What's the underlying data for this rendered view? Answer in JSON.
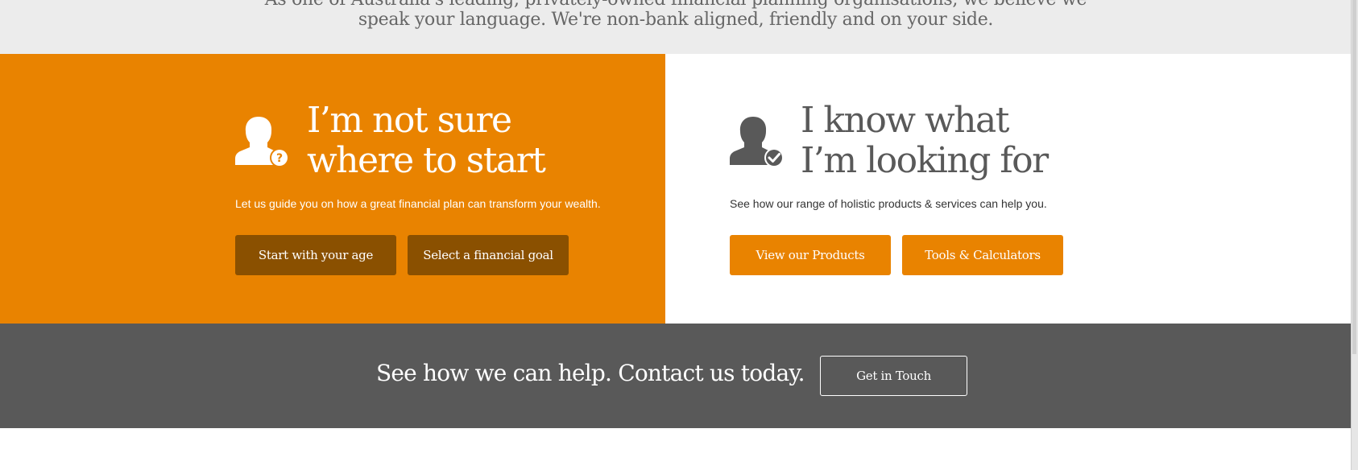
{
  "intro": {
    "line1": "As one of Australia's leading, privately-owned financial planning organisations, we believe we",
    "line2": "speak your language. We're non-bank aligned, friendly and on your side."
  },
  "colors": {
    "brand_orange": "#e98300",
    "dark_orange": "#8a5000",
    "charcoal": "#595959",
    "light_gray": "#ececec"
  },
  "not_sure": {
    "icon": "person-question-icon",
    "heading_line1": "I’m not sure",
    "heading_line2": "where to start",
    "description": "Let us guide you on how a great financial plan can transform your wealth.",
    "buttons": [
      "Start with your age",
      "Select a financial goal"
    ]
  },
  "know_what": {
    "icon": "person-check-icon",
    "heading_line1": "I know what",
    "heading_line2": "I’m looking for",
    "description": "See how our range of holistic products & services can help you.",
    "buttons": [
      "View our Products",
      "Tools & Calculators"
    ]
  },
  "contact": {
    "text": "See how we can help. Contact us today.",
    "button": "Get in Touch"
  }
}
